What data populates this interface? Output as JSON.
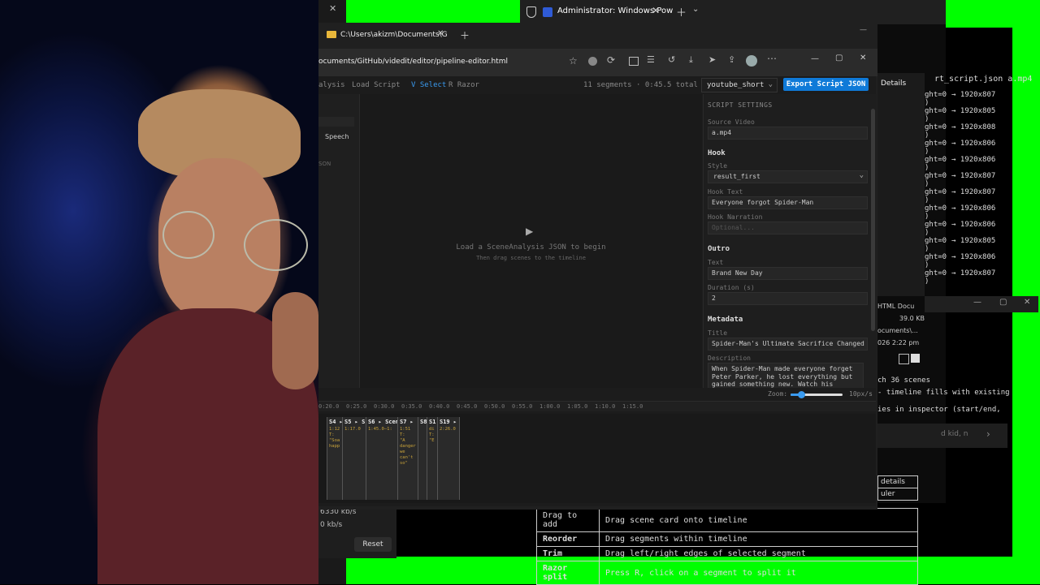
{
  "explorer_tab": {
    "title": "C:\\Users\\akizm\\Documents\\G"
  },
  "powershell_tab": {
    "title": "Administrator: Windows Pow"
  },
  "browser": {
    "url": "ocuments/GitHub/videdit/editor/pipeline-editor.html"
  },
  "toolbar": {
    "items": [
      "alysis",
      "Load Script",
      "V Select",
      "R Razor"
    ],
    "segments_info": "11 segments · 0:45.5 total",
    "preset": "youtube_short",
    "export_label": "Export Script JSON"
  },
  "left_panel": {
    "tab_speech": "Speech",
    "json_hint": "SON"
  },
  "canvas": {
    "title": "Load a SceneAnalysis JSON to begin",
    "subtitle": "Then drag scenes to the timeline"
  },
  "inspector": {
    "header": "SCRIPT SETTINGS",
    "source_video_label": "Source Video",
    "source_video": "a.mp4",
    "hook_section": "Hook",
    "style_label": "Style",
    "style_value": "result_first",
    "hook_text_label": "Hook Text",
    "hook_text": "Everyone forgot Spider-Man",
    "hook_narration_label": "Hook Narration",
    "hook_narration_placeholder": "Optional...",
    "outro_section": "Outro",
    "text_label": "Text",
    "outro_text": "Brand New Day",
    "duration_label": "Duration (s)",
    "duration": "2",
    "metadata_section": "Metadata",
    "title_label": "Title",
    "title": "Spider-Man's Ultimate Sacrifice Changed Eve",
    "description_label": "Description",
    "description": "When Spider-Man made everyone forget Peter Parker, he lost everything but gained something new. Watch his journey"
  },
  "zoom": {
    "label": "Zoom:",
    "value": "10px/s",
    "level": 0.2
  },
  "ruler": [
    "0:20.0",
    "0:25.0",
    "0:30.0",
    "0:35.0",
    "0:40.0",
    "0:45.0",
    "0:50.0",
    "0:55.0",
    "1:00.0",
    "1:05.0",
    "1:10.0",
    "1:15.0"
  ],
  "segments": [
    {
      "label": "S4 ▸",
      "detail": "1:12\nT:\n\"Soa\nhapp"
    },
    {
      "label": "S5 ▸ S",
      "detail": "1:17.0"
    },
    {
      "label": "S6 ▸ Scen",
      "detail": "1:45.0–1:"
    },
    {
      "label": "S7 ▸",
      "detail": "1:51\nT:\n\"A\ndanger\nwe\ncan't\nso\""
    },
    {
      "label": "S8",
      "detail": ""
    },
    {
      "label": "S1",
      "detail": "di\nT:\n\"E"
    },
    {
      "label": "S19 ▸",
      "detail": "2:26.0"
    }
  ],
  "terminal": {
    "top_text": "rt_script.json a.mp4",
    "lines": [
      {
        "left": "ght=0",
        "right": "→ 1920x807"
      },
      {
        "left": "ght=0",
        "right": "→ 1920x805"
      },
      {
        "left": "ght=0",
        "right": "→ 1920x808"
      },
      {
        "left": "ght=0",
        "right": "→ 1920x806"
      },
      {
        "left": "ght=0",
        "right": "→ 1920x806"
      },
      {
        "left": "ght=0",
        "right": "→ 1920x807"
      },
      {
        "left": "ght=0",
        "right": "→ 1920x807"
      },
      {
        "left": "ght=0",
        "right": "→ 1920x806"
      },
      {
        "left": "ght=0",
        "right": "→ 1920x806"
      },
      {
        "left": "ght=0",
        "right": "→ 1920x805"
      },
      {
        "left": "ght=0",
        "right": "→ 1920x806"
      },
      {
        "left": "ght=0",
        "right": "→ 1920x807"
      }
    ]
  },
  "details_label": "Details",
  "file_info": {
    "type": "HTML Docu",
    "size": "39.0 KB",
    "path": "ocuments\\...",
    "date": "026 2:22 pm"
  },
  "notes": {
    "line1": "ch 36 scenes",
    "line2": "- timeline fills with existing",
    "line3": "ies in inspector (start/end,",
    "input_hint": "d kid, n"
  },
  "stats": {
    "bitrate1": "6330 kb/s",
    "bitrate2": "0 kb/s",
    "reset": "Reset"
  },
  "mini_table": {
    "r1": "details",
    "r2": "uler"
  },
  "shortcuts": [
    {
      "action": "Drag to add",
      "desc": "Drag scene card onto timeline"
    },
    {
      "action": "Reorder",
      "desc": "Drag segments within timeline"
    },
    {
      "action": "Trim",
      "desc": "Drag left/right edges of selected segment"
    },
    {
      "action": "Razor split",
      "desc": "Press R, click on a segment to split it"
    }
  ]
}
